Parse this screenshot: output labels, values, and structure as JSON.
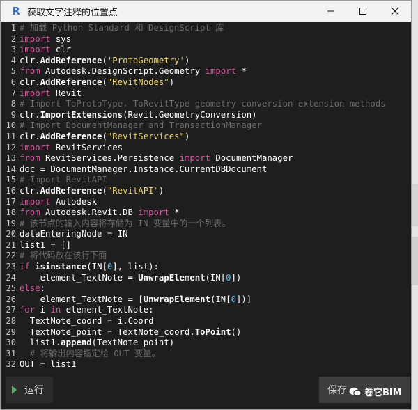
{
  "window": {
    "title": "获取文字注释的位置点",
    "app_icon_letter": "R",
    "controls": [
      "minimize-icon",
      "maximize-icon",
      "close-icon"
    ]
  },
  "editor": {
    "lines": [
      {
        "n": "1",
        "tokens": [
          {
            "t": "comment",
            "v": "# 加载 Python Standard 和 DesignScript 库"
          }
        ]
      },
      {
        "n": "2",
        "tokens": [
          {
            "t": "keyword",
            "v": "import"
          },
          {
            "t": "plain",
            "v": " sys"
          }
        ]
      },
      {
        "n": "3",
        "tokens": [
          {
            "t": "keyword",
            "v": "import"
          },
          {
            "t": "plain",
            "v": " clr"
          }
        ]
      },
      {
        "n": "4",
        "tokens": [
          {
            "t": "plain",
            "v": "clr."
          },
          {
            "t": "bold",
            "v": "AddReference"
          },
          {
            "t": "plain",
            "v": "("
          },
          {
            "t": "string",
            "v": "'ProtoGeometry'"
          },
          {
            "t": "plain",
            "v": ")"
          }
        ]
      },
      {
        "n": "5",
        "tokens": [
          {
            "t": "keyword",
            "v": "from"
          },
          {
            "t": "plain",
            "v": " Autodesk.DesignScript.Geometry "
          },
          {
            "t": "keyword",
            "v": "import"
          },
          {
            "t": "plain",
            "v": " *"
          }
        ]
      },
      {
        "n": "6",
        "tokens": [
          {
            "t": "plain",
            "v": "clr."
          },
          {
            "t": "bold",
            "v": "AddReference"
          },
          {
            "t": "plain",
            "v": "("
          },
          {
            "t": "string",
            "v": "\"RevitNodes\""
          },
          {
            "t": "plain",
            "v": ")"
          }
        ]
      },
      {
        "n": "7",
        "tokens": [
          {
            "t": "keyword",
            "v": "import"
          },
          {
            "t": "plain",
            "v": " Revit"
          }
        ]
      },
      {
        "n": "8",
        "tokens": [
          {
            "t": "comment",
            "v": "# Import ToProtoType, ToRevitType geometry conversion extension methods"
          }
        ]
      },
      {
        "n": "9",
        "tokens": [
          {
            "t": "plain",
            "v": "clr."
          },
          {
            "t": "bold",
            "v": "ImportExtensions"
          },
          {
            "t": "plain",
            "v": "(Revit.GeometryConversion)"
          }
        ]
      },
      {
        "n": "10",
        "tokens": [
          {
            "t": "comment",
            "v": "# Import DocumentManager and TransactionManager"
          }
        ]
      },
      {
        "n": "11",
        "tokens": [
          {
            "t": "plain",
            "v": "clr."
          },
          {
            "t": "bold",
            "v": "AddReference"
          },
          {
            "t": "plain",
            "v": "("
          },
          {
            "t": "string",
            "v": "\"RevitServices\""
          },
          {
            "t": "plain",
            "v": ")"
          }
        ]
      },
      {
        "n": "12",
        "tokens": [
          {
            "t": "keyword",
            "v": "import"
          },
          {
            "t": "plain",
            "v": " RevitServices"
          }
        ]
      },
      {
        "n": "13",
        "tokens": [
          {
            "t": "keyword",
            "v": "from"
          },
          {
            "t": "plain",
            "v": " RevitServices.Persistence "
          },
          {
            "t": "keyword",
            "v": "import"
          },
          {
            "t": "plain",
            "v": " DocumentManager"
          }
        ]
      },
      {
        "n": "14",
        "tokens": [
          {
            "t": "plain",
            "v": "doc = DocumentManager.Instance.CurrentDBDocument"
          }
        ]
      },
      {
        "n": "15",
        "tokens": [
          {
            "t": "comment",
            "v": "# Import RevitAPI"
          }
        ]
      },
      {
        "n": "16",
        "tokens": [
          {
            "t": "plain",
            "v": "clr."
          },
          {
            "t": "bold",
            "v": "AddReference"
          },
          {
            "t": "plain",
            "v": "("
          },
          {
            "t": "string",
            "v": "\"RevitAPI\""
          },
          {
            "t": "plain",
            "v": ")"
          }
        ]
      },
      {
        "n": "17",
        "tokens": [
          {
            "t": "keyword",
            "v": "import"
          },
          {
            "t": "plain",
            "v": " Autodesk"
          }
        ]
      },
      {
        "n": "18",
        "tokens": [
          {
            "t": "keyword",
            "v": "from"
          },
          {
            "t": "plain",
            "v": " Autodesk.Revit.DB "
          },
          {
            "t": "keyword",
            "v": "import"
          },
          {
            "t": "plain",
            "v": " *"
          }
        ]
      },
      {
        "n": "19",
        "tokens": [
          {
            "t": "comment",
            "v": "# 该节点的输入内容将存储为 IN 变量中的一个列表。"
          }
        ]
      },
      {
        "n": "20",
        "tokens": [
          {
            "t": "plain",
            "v": "dataEnteringNode = IN"
          }
        ]
      },
      {
        "n": "21",
        "tokens": [
          {
            "t": "plain",
            "v": "list1 = []"
          }
        ]
      },
      {
        "n": "22",
        "tokens": [
          {
            "t": "comment",
            "v": "# 将代码放在该行下面"
          }
        ]
      },
      {
        "n": "23",
        "tokens": [
          {
            "t": "keyword",
            "v": "if"
          },
          {
            "t": "plain",
            "v": " "
          },
          {
            "t": "bold",
            "v": "isinstance"
          },
          {
            "t": "plain",
            "v": "(IN["
          },
          {
            "t": "number",
            "v": "0"
          },
          {
            "t": "plain",
            "v": "], list):"
          }
        ]
      },
      {
        "n": "24",
        "tokens": [
          {
            "t": "plain",
            "v": "    element_TextNote = "
          },
          {
            "t": "bold",
            "v": "UnwrapElement"
          },
          {
            "t": "plain",
            "v": "(IN["
          },
          {
            "t": "number",
            "v": "0"
          },
          {
            "t": "plain",
            "v": "])"
          }
        ]
      },
      {
        "n": "25",
        "tokens": [
          {
            "t": "keyword",
            "v": "else"
          },
          {
            "t": "plain",
            "v": ":"
          }
        ]
      },
      {
        "n": "26",
        "tokens": [
          {
            "t": "plain",
            "v": "    element_TextNote = ["
          },
          {
            "t": "bold",
            "v": "UnwrapElement"
          },
          {
            "t": "plain",
            "v": "(IN["
          },
          {
            "t": "number",
            "v": "0"
          },
          {
            "t": "plain",
            "v": "])]"
          }
        ]
      },
      {
        "n": "27",
        "tokens": [
          {
            "t": "keyword",
            "v": "for"
          },
          {
            "t": "plain",
            "v": " i "
          },
          {
            "t": "keyword",
            "v": "in"
          },
          {
            "t": "plain",
            "v": " element_TextNote:"
          }
        ]
      },
      {
        "n": "28",
        "tokens": [
          {
            "t": "plain",
            "v": "  TextNote_coord = i.Coord"
          }
        ]
      },
      {
        "n": "29",
        "tokens": [
          {
            "t": "plain",
            "v": "  TextNote_point = TextNote_coord."
          },
          {
            "t": "bold",
            "v": "ToPoint"
          },
          {
            "t": "plain",
            "v": "()"
          }
        ]
      },
      {
        "n": "30",
        "tokens": [
          {
            "t": "plain",
            "v": "  list1."
          },
          {
            "t": "bold",
            "v": "append"
          },
          {
            "t": "plain",
            "v": "(TextNote_point)"
          }
        ]
      },
      {
        "n": "31",
        "tokens": [
          {
            "t": "comment",
            "v": "  # 将输出内容指定给 OUT 变量。"
          }
        ]
      },
      {
        "n": "32",
        "tokens": [
          {
            "t": "plain",
            "v": "OUT = list1"
          }
        ]
      }
    ]
  },
  "footer": {
    "run_label": "运行",
    "save_label": "保存",
    "watermark": "卷它BIM"
  },
  "colors": {
    "background": "#1e1e1e",
    "comment": "#6b6b6b",
    "keyword": "#d25aa0",
    "string": "#ebd36a",
    "number": "#4fc1ff",
    "run_icon": "#5cb16b"
  }
}
